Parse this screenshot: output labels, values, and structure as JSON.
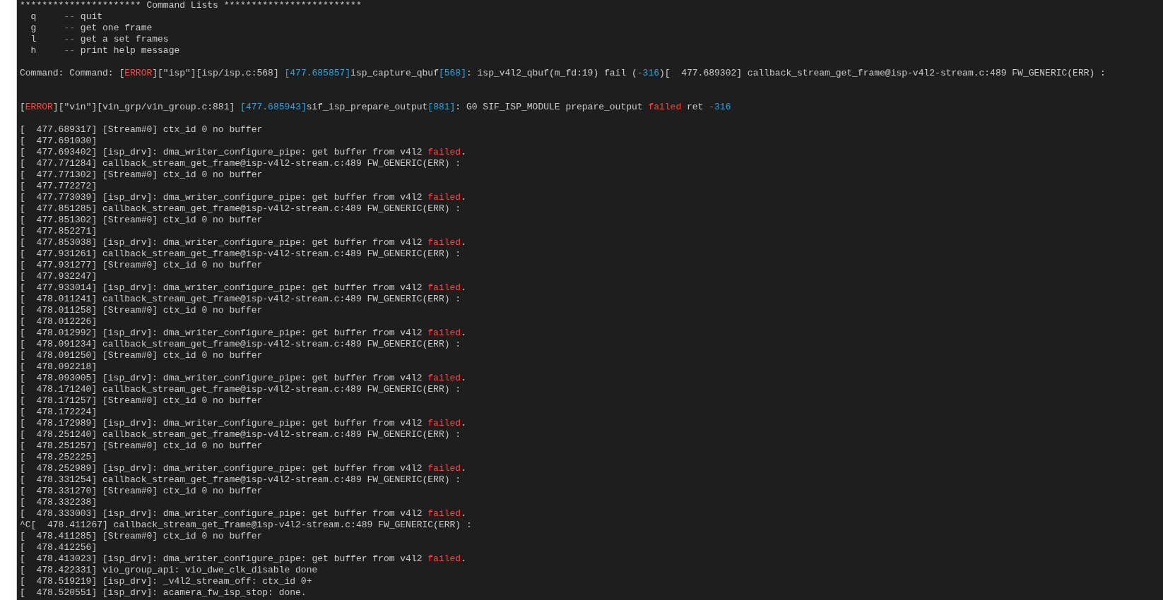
{
  "command_list": {
    "title": "********************** Command Lists *************************",
    "items": [
      {
        "key": "q",
        "dash": "--",
        "label": "quit"
      },
      {
        "key": "g",
        "dash": "--",
        "label": "get one frame"
      },
      {
        "key": "l",
        "dash": "--",
        "label": "get a set frames"
      },
      {
        "key": "h",
        "dash": "--",
        "label": "print help message"
      }
    ]
  },
  "command_output": [
    {
      "segments": [
        {
          "kind": "plain",
          "text": "Command: Command: ["
        },
        {
          "kind": "error",
          "text": "ERROR"
        },
        {
          "kind": "plain",
          "text": "][\"isp\"][isp/isp.c:568] "
        },
        {
          "kind": "info",
          "text": "[477.685857]"
        },
        {
          "kind": "plain",
          "text": "isp_capture_qbuf"
        },
        {
          "kind": "info",
          "text": "[568]"
        },
        {
          "kind": "plain",
          "text": ": isp_v4l2_qbuf(m_fd:19) fail ("
        },
        {
          "kind": "info",
          "text": "-316"
        },
        {
          "kind": "plain",
          "text": ")[  477.689302] callback_stream_get_frame@isp-v4l2-stream.c:489 FW_GENERIC(ERR) :"
        }
      ]
    }
  ],
  "error_output": [
    {
      "segments": [
        {
          "kind": "plain",
          "text": "["
        },
        {
          "kind": "error",
          "text": "ERROR"
        },
        {
          "kind": "plain",
          "text": "][\"vin\"][vin_grp/vin_group.c:881] "
        },
        {
          "kind": "info",
          "text": "[477.685943]"
        },
        {
          "kind": "plain",
          "text": "sif_isp_prepare_output"
        },
        {
          "kind": "info",
          "text": "[881]"
        },
        {
          "kind": "plain",
          "text": ": G0 SIF_ISP_MODULE prepare_output "
        },
        {
          "kind": "error",
          "text": "failed"
        },
        {
          "kind": "plain",
          "text": " ret "
        },
        {
          "kind": "info",
          "text": "-316"
        }
      ]
    }
  ],
  "log": [
    {
      "text": "[  477.689317] [Stream#0] ctx_id 0 no buffer"
    },
    {
      "text": "[  477.691030]"
    },
    {
      "text": "[  477.693402] [isp_drv]: dma_writer_configure_pipe: get buffer from v4l2 ",
      "failed": "failed",
      "end": "."
    },
    {
      "text": "[  477.771284] callback_stream_get_frame@isp-v4l2-stream.c:489 FW_GENERIC(ERR) :"
    },
    {
      "text": "[  477.771302] [Stream#0] ctx_id 0 no buffer"
    },
    {
      "text": "[  477.772272]"
    },
    {
      "text": "[  477.773039] [isp_drv]: dma_writer_configure_pipe: get buffer from v4l2 ",
      "failed": "failed",
      "end": "."
    },
    {
      "text": "[  477.851285] callback_stream_get_frame@isp-v4l2-stream.c:489 FW_GENERIC(ERR) :"
    },
    {
      "text": "[  477.851302] [Stream#0] ctx_id 0 no buffer"
    },
    {
      "text": "[  477.852271]"
    },
    {
      "text": "[  477.853038] [isp_drv]: dma_writer_configure_pipe: get buffer from v4l2 ",
      "failed": "failed",
      "end": "."
    },
    {
      "text": "[  477.931261] callback_stream_get_frame@isp-v4l2-stream.c:489 FW_GENERIC(ERR) :"
    },
    {
      "text": "[  477.931277] [Stream#0] ctx_id 0 no buffer"
    },
    {
      "text": "[  477.932247]"
    },
    {
      "text": "[  477.933014] [isp_drv]: dma_writer_configure_pipe: get buffer from v4l2 ",
      "failed": "failed",
      "end": "."
    },
    {
      "text": "[  478.011241] callback_stream_get_frame@isp-v4l2-stream.c:489 FW_GENERIC(ERR) :"
    },
    {
      "text": "[  478.011258] [Stream#0] ctx_id 0 no buffer"
    },
    {
      "text": "[  478.012226]"
    },
    {
      "text": "[  478.012992] [isp_drv]: dma_writer_configure_pipe: get buffer from v4l2 ",
      "failed": "failed",
      "end": "."
    },
    {
      "text": "[  478.091234] callback_stream_get_frame@isp-v4l2-stream.c:489 FW_GENERIC(ERR) :"
    },
    {
      "text": "[  478.091250] [Stream#0] ctx_id 0 no buffer"
    },
    {
      "text": "[  478.092218]"
    },
    {
      "text": "[  478.093005] [isp_drv]: dma_writer_configure_pipe: get buffer from v4l2 ",
      "failed": "failed",
      "end": "."
    },
    {
      "text": "[  478.171240] callback_stream_get_frame@isp-v4l2-stream.c:489 FW_GENERIC(ERR) :"
    },
    {
      "text": "[  478.171257] [Stream#0] ctx_id 0 no buffer"
    },
    {
      "text": "[  478.172224]"
    },
    {
      "text": "[  478.172989] [isp_drv]: dma_writer_configure_pipe: get buffer from v4l2 ",
      "failed": "failed",
      "end": "."
    },
    {
      "text": "[  478.251240] callback_stream_get_frame@isp-v4l2-stream.c:489 FW_GENERIC(ERR) :"
    },
    {
      "text": "[  478.251257] [Stream#0] ctx_id 0 no buffer"
    },
    {
      "text": "[  478.252225]"
    },
    {
      "text": "[  478.252989] [isp_drv]: dma_writer_configure_pipe: get buffer from v4l2 ",
      "failed": "failed",
      "end": "."
    },
    {
      "text": "[  478.331254] callback_stream_get_frame@isp-v4l2-stream.c:489 FW_GENERIC(ERR) :"
    },
    {
      "text": "[  478.331270] [Stream#0] ctx_id 0 no buffer"
    },
    {
      "text": "[  478.332238]"
    },
    {
      "text": "[  478.333003] [isp_drv]: dma_writer_configure_pipe: get buffer from v4l2 ",
      "failed": "failed",
      "end": "."
    },
    {
      "text": "^C[  478.411267] callback_stream_get_frame@isp-v4l2-stream.c:489 FW_GENERIC(ERR) :"
    },
    {
      "text": "[  478.411285] [Stream#0] ctx_id 0 no buffer"
    },
    {
      "text": "[  478.412256]"
    },
    {
      "text": "[  478.413023] [isp_drv]: dma_writer_configure_pipe: get buffer from v4l2 ",
      "failed": "failed",
      "end": "."
    },
    {
      "text": "[  478.422331] vio_group_api: vio_dwe_clk_disable done"
    },
    {
      "text": "[  478.519219] [isp_drv]: _v4l2_stream_off: ctx_id 0+"
    },
    {
      "text": "[  478.520551] [isp_drv]: acamera_fw_isp_stop: done."
    }
  ]
}
